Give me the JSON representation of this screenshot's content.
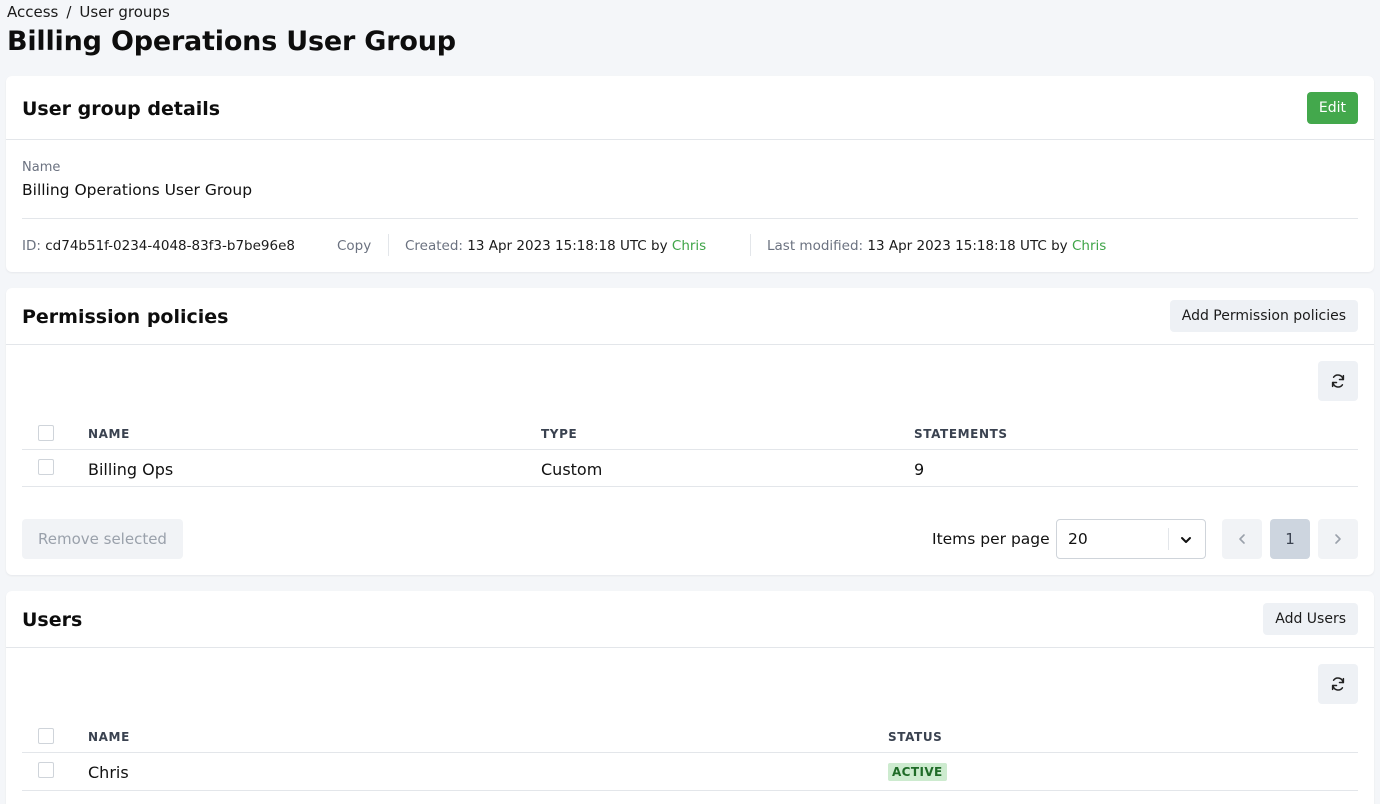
{
  "breadcrumb": {
    "root": "Access",
    "separator": "/",
    "current": "User groups"
  },
  "page_title": "Billing Operations User Group",
  "details": {
    "title": "User group details",
    "edit_label": "Edit",
    "name_label": "Name",
    "name_value": "Billing Operations User Group",
    "id_label": "ID:",
    "id_value": "cd74b51f-0234-4048-83f3-b7be96e8",
    "copy_label": "Copy",
    "created_label": "Created:",
    "created_value": "13 Apr 2023 15:18:18 UTC by",
    "created_by": "Chris",
    "modified_label": "Last modified:",
    "modified_value": "13 Apr 2023 15:18:18 UTC by",
    "modified_by": "Chris"
  },
  "policies": {
    "title": "Permission policies",
    "add_label": "Add Permission policies",
    "refresh_icon": "refresh-icon",
    "columns": [
      "NAME",
      "TYPE",
      "STATEMENTS"
    ],
    "rows": [
      {
        "name": "Billing Ops",
        "type": "Custom",
        "statements": "9"
      }
    ],
    "remove_label": "Remove selected",
    "items_per_page_label": "Items per page",
    "items_per_page_value": "20",
    "current_page": "1"
  },
  "users": {
    "title": "Users",
    "add_label": "Add Users",
    "refresh_icon": "refresh-icon",
    "columns": [
      "NAME",
      "STATUS"
    ],
    "rows": [
      {
        "name": "Chris",
        "status": "ACTIVE"
      }
    ]
  },
  "colors": {
    "accent": "#43a84c",
    "link": "#3ea447",
    "badge_bg": "#cdebcf"
  }
}
